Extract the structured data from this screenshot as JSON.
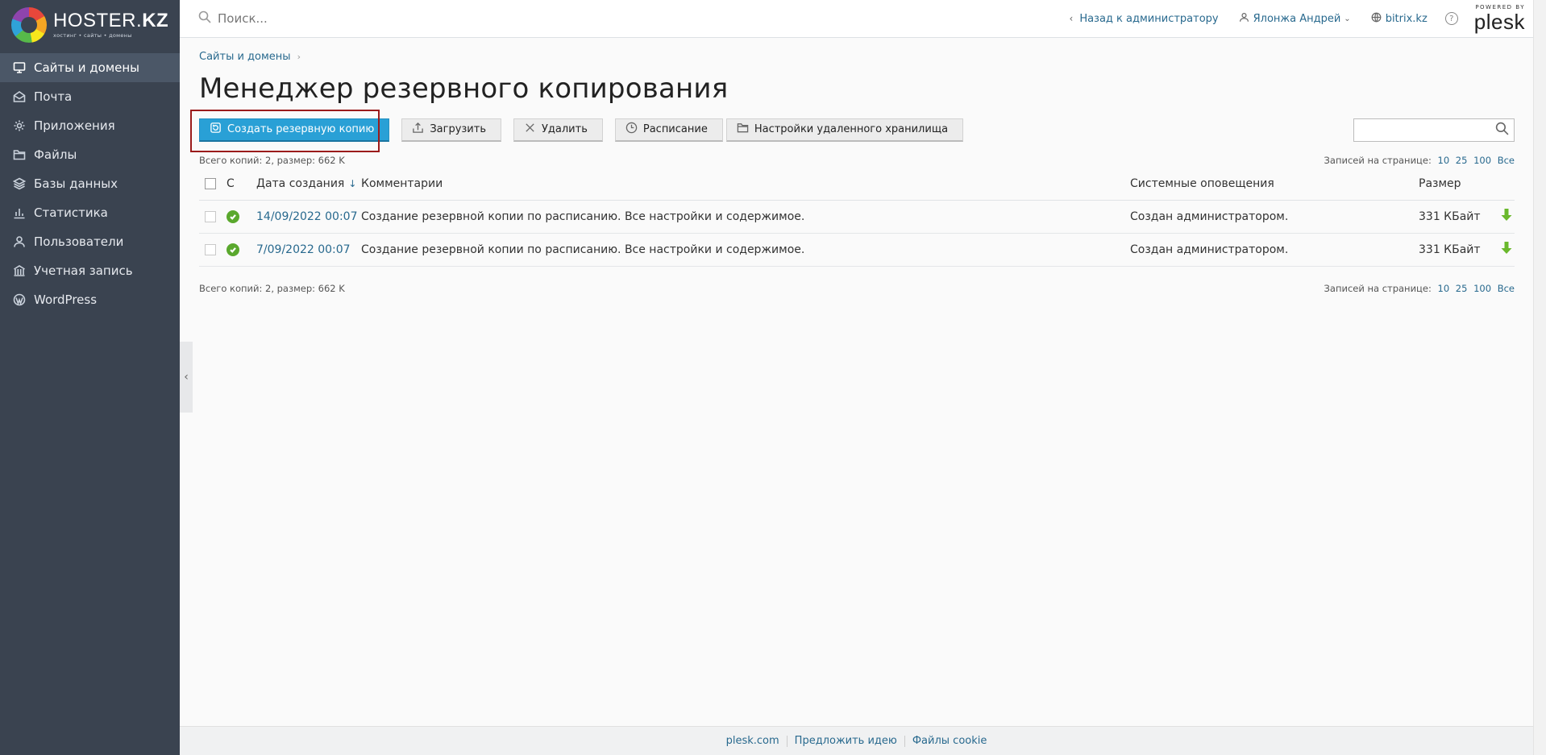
{
  "brand": {
    "name_light": "HOSTER.",
    "name_bold": "KZ",
    "tagline": "хостинг • сайты • домены"
  },
  "sidebar": {
    "items": [
      {
        "label": "Сайты и домены",
        "icon": "monitor-icon",
        "active": true
      },
      {
        "label": "Почта",
        "icon": "mail-icon"
      },
      {
        "label": "Приложения",
        "icon": "gear-icon"
      },
      {
        "label": "Файлы",
        "icon": "folder-icon"
      },
      {
        "label": "Базы данных",
        "icon": "layers-icon"
      },
      {
        "label": "Статистика",
        "icon": "bar-chart-icon"
      },
      {
        "label": "Пользователи",
        "icon": "user-icon"
      },
      {
        "label": "Учетная запись",
        "icon": "account-icon"
      },
      {
        "label": "WordPress",
        "icon": "wordpress-icon"
      }
    ]
  },
  "topbar": {
    "search_placeholder": "Поиск...",
    "back_label": "Назад к администратору",
    "user_label": "Ялонжа Андрей",
    "domain_label": "bitrix.kz",
    "help_glyph": "?",
    "powered_by": "POWERED BY",
    "plesk_name": "plesk"
  },
  "breadcrumb": {
    "item": "Сайты и домены"
  },
  "page": {
    "title": "Менеджер резервного копирования"
  },
  "toolbar": {
    "create_label": "Создать резервную копию",
    "upload_label": "Загрузить",
    "delete_label": "Удалить",
    "schedule_label": "Расписание",
    "remote_label": "Настройки удаленного хранилища"
  },
  "list": {
    "summary": "Всего копий: 2, размер: 662 K",
    "per_page_label": "Записей на странице:",
    "per_page_options": [
      "10",
      "25",
      "100",
      "Все"
    ],
    "columns": {
      "status": "С",
      "date": "Дата создания",
      "sort_glyph": "↓",
      "comments": "Комментарии",
      "notifications": "Системные оповещения",
      "size": "Размер"
    },
    "rows": [
      {
        "date": "14/09/2022 00:07",
        "comment": "Создание резервной копии по расписанию. Все настройки и содержимое.",
        "notification": "Создан администратором.",
        "size": "331 КБайт"
      },
      {
        "date": "7/09/2022 00:07",
        "comment": "Создание резервной копии по расписанию. Все настройки и содержимое.",
        "notification": "Создан администратором.",
        "size": "331 КБайт"
      }
    ]
  },
  "footer": {
    "links": [
      "plesk.com",
      "Предложить идею",
      "Файлы cookie"
    ]
  },
  "colors": {
    "sidebar_bg": "#3a4350",
    "primary_button": "#29a0d6",
    "link": "#28698e",
    "status_ok": "#5aa82d",
    "download": "#6ab82c",
    "highlight": "#9b1b1b"
  }
}
